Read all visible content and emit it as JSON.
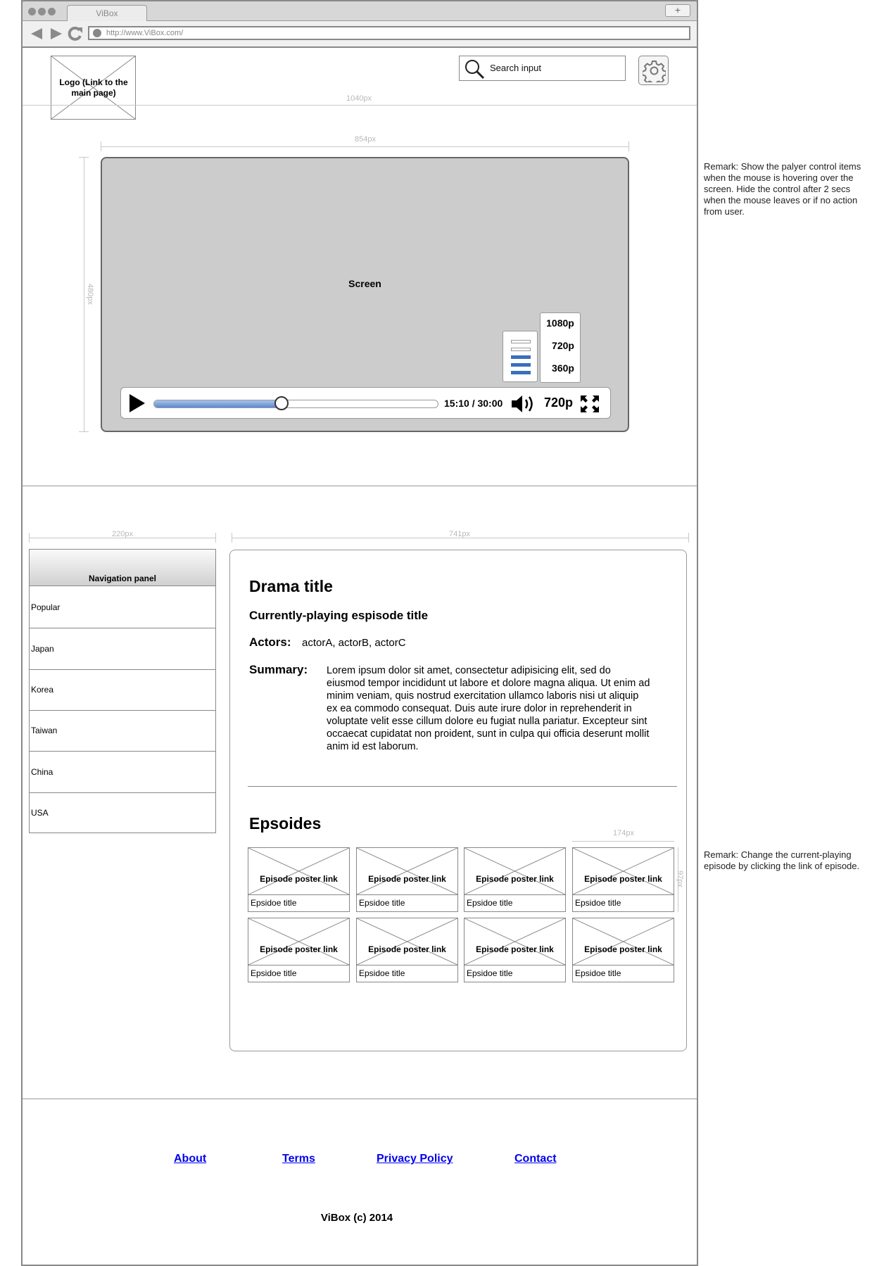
{
  "browser": {
    "tab_title": "ViBox",
    "new_tab": "+",
    "url": "http://www.ViBox.com/"
  },
  "header": {
    "logo_text": "Logo (Link to the main page)",
    "search_placeholder": "Search input",
    "page_width_label": "1040px"
  },
  "player": {
    "width_label": "854px",
    "height_label": "480px",
    "screen_label": "Screen",
    "time": "15:10 / 30:00",
    "resolution": "720p",
    "progress_fraction": 0.45,
    "volume_level_bars": 3,
    "volume_total_bars": 5,
    "quality_options": [
      "1080p",
      "720p",
      "360p"
    ]
  },
  "navigation": {
    "width_label": "220px",
    "header": "Navigation panel",
    "items": [
      "Popular",
      "Japan",
      "Korea",
      "Taiwan",
      "China",
      "USA"
    ]
  },
  "content": {
    "width_label": "741px",
    "drama_title": "Drama title",
    "episode_title": "Currently-playing espisode title",
    "actors_label": "Actors:",
    "actors": "actorA, actorB, actorC",
    "summary_label": "Summary:",
    "summary": "Lorem ipsum dolor sit amet, consectetur adipisicing elit, sed do eiusmod tempor incididunt ut labore et dolore magna aliqua. Ut enim ad minim veniam, quis nostrud exercitation ullamco laboris nisi ut aliquip ex ea commodo consequat. Duis aute irure dolor in reprehenderit in voluptate velit esse cillum dolore eu fugiat nulla pariatur. Excepteur sint occaecat cupidatat non proident, sunt in culpa qui officia deserunt mollit anim id est laborum.",
    "episodes_title": "Epsoides",
    "card_width_label": "174px",
    "card_height_label": "97px",
    "episodes": [
      {
        "poster": "Episode poster link",
        "title": "Epsidoe title"
      },
      {
        "poster": "Episode poster link",
        "title": "Epsidoe title"
      },
      {
        "poster": "Episode poster link",
        "title": "Epsidoe title"
      },
      {
        "poster": "Episode poster link",
        "title": "Epsidoe title"
      },
      {
        "poster": "Episode poster link",
        "title": "Epsidoe title"
      },
      {
        "poster": "Episode poster link",
        "title": "Epsidoe title"
      },
      {
        "poster": "Episode poster link",
        "title": "Epsidoe title"
      },
      {
        "poster": "Episode poster link",
        "title": "Epsidoe title"
      }
    ]
  },
  "remarks": [
    "Remark: Show the palyer control items when the mouse is hovering over the screen. Hide the control after 2 secs when the mouse leaves or if no action from user.",
    "Remark: Change the current-playing episode by clicking the link of episode."
  ],
  "footer": {
    "links": [
      "About",
      "Terms",
      "Privacy Policy",
      "Contact"
    ],
    "copyright": "ViBox (c) 2014"
  }
}
